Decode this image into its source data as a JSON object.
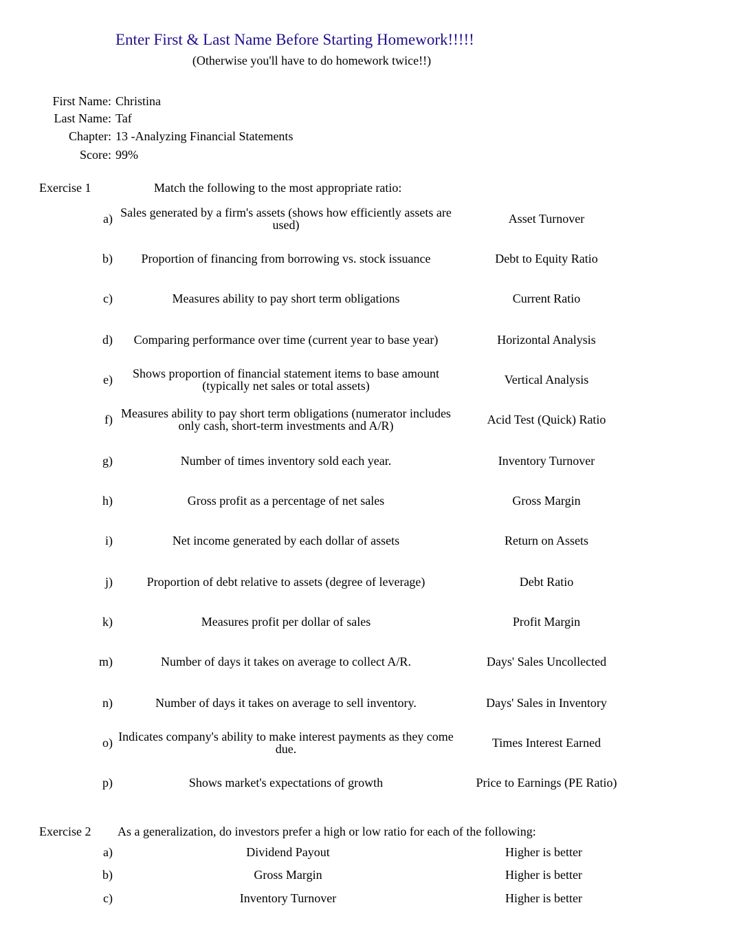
{
  "header": {
    "title": "Enter First & Last Name Before Starting Homework!!!!!",
    "subtitle": "(Otherwise you'll have to do homework twice!!)",
    "title_color": "#1f0f8c"
  },
  "info": {
    "first_name_label": "First Name:",
    "first_name": "Christina",
    "last_name_label": "Last Name:",
    "last_name": "Taf",
    "chapter_label": "Chapter:",
    "chapter": "13 -Analyzing Financial Statements",
    "score_label": "Score:",
    "score": "99%"
  },
  "exercise1": {
    "label": "Exercise 1",
    "instruction": "Match the following to the most appropriate ratio:",
    "items": [
      {
        "letter": "a)",
        "description": "Sales generated by a firm's assets (shows how efficiently assets are used)",
        "answer": "Asset Turnover"
      },
      {
        "letter": "b)",
        "description": "Proportion of financing from borrowing vs. stock issuance",
        "answer": "Debt to Equity Ratio"
      },
      {
        "letter": "c)",
        "description": "Measures ability to pay short term obligations",
        "answer": "Current Ratio"
      },
      {
        "letter": "d)",
        "description": "Comparing performance over time (current year to base year)",
        "answer": "Horizontal Analysis"
      },
      {
        "letter": "e)",
        "description": "Shows proportion of financial statement items to base amount (typically net sales or total assets)",
        "answer": "Vertical Analysis"
      },
      {
        "letter": "f)",
        "description": "Measures ability to pay short term obligations (numerator includes only cash, short-term investments and A/R)",
        "answer": "Acid Test (Quick) Ratio"
      },
      {
        "letter": "g)",
        "description": "Number of times inventory sold each year.",
        "answer": "Inventory Turnover"
      },
      {
        "letter": "h)",
        "description": "Gross profit as a percentage of net sales",
        "answer": "Gross Margin"
      },
      {
        "letter": "i)",
        "description": "Net income generated by each dollar of assets",
        "answer": "Return on Assets"
      },
      {
        "letter": "j)",
        "description": "Proportion of debt relative to assets (degree of leverage)",
        "answer": "Debt Ratio"
      },
      {
        "letter": "k)",
        "description": "Measures profit per dollar of sales",
        "answer": "Profit Margin"
      },
      {
        "letter": "m)",
        "description": "Number of days it takes on average to collect A/R.",
        "answer": "Days' Sales Uncollected"
      },
      {
        "letter": "n)",
        "description": "Number of days it takes on average to sell inventory.",
        "answer": "Days' Sales in Inventory"
      },
      {
        "letter": "o)",
        "description": "Indicates company's ability to make interest payments as they come due.",
        "answer": "Times Interest Earned"
      },
      {
        "letter": "p)",
        "description": "Shows market's expectations of growth",
        "answer": "Price to Earnings (PE Ratio)"
      }
    ]
  },
  "exercise2": {
    "label": "Exercise 2",
    "instruction": "As a generalization, do investors prefer a high or low ratio for each of the following:",
    "items": [
      {
        "letter": "a)",
        "ratio": "Dividend Payout",
        "answer": "Higher is better"
      },
      {
        "letter": "b)",
        "ratio": "Gross Margin",
        "answer": "Higher is better"
      },
      {
        "letter": "c)",
        "ratio": "Inventory Turnover",
        "answer": "Higher is better"
      }
    ]
  }
}
